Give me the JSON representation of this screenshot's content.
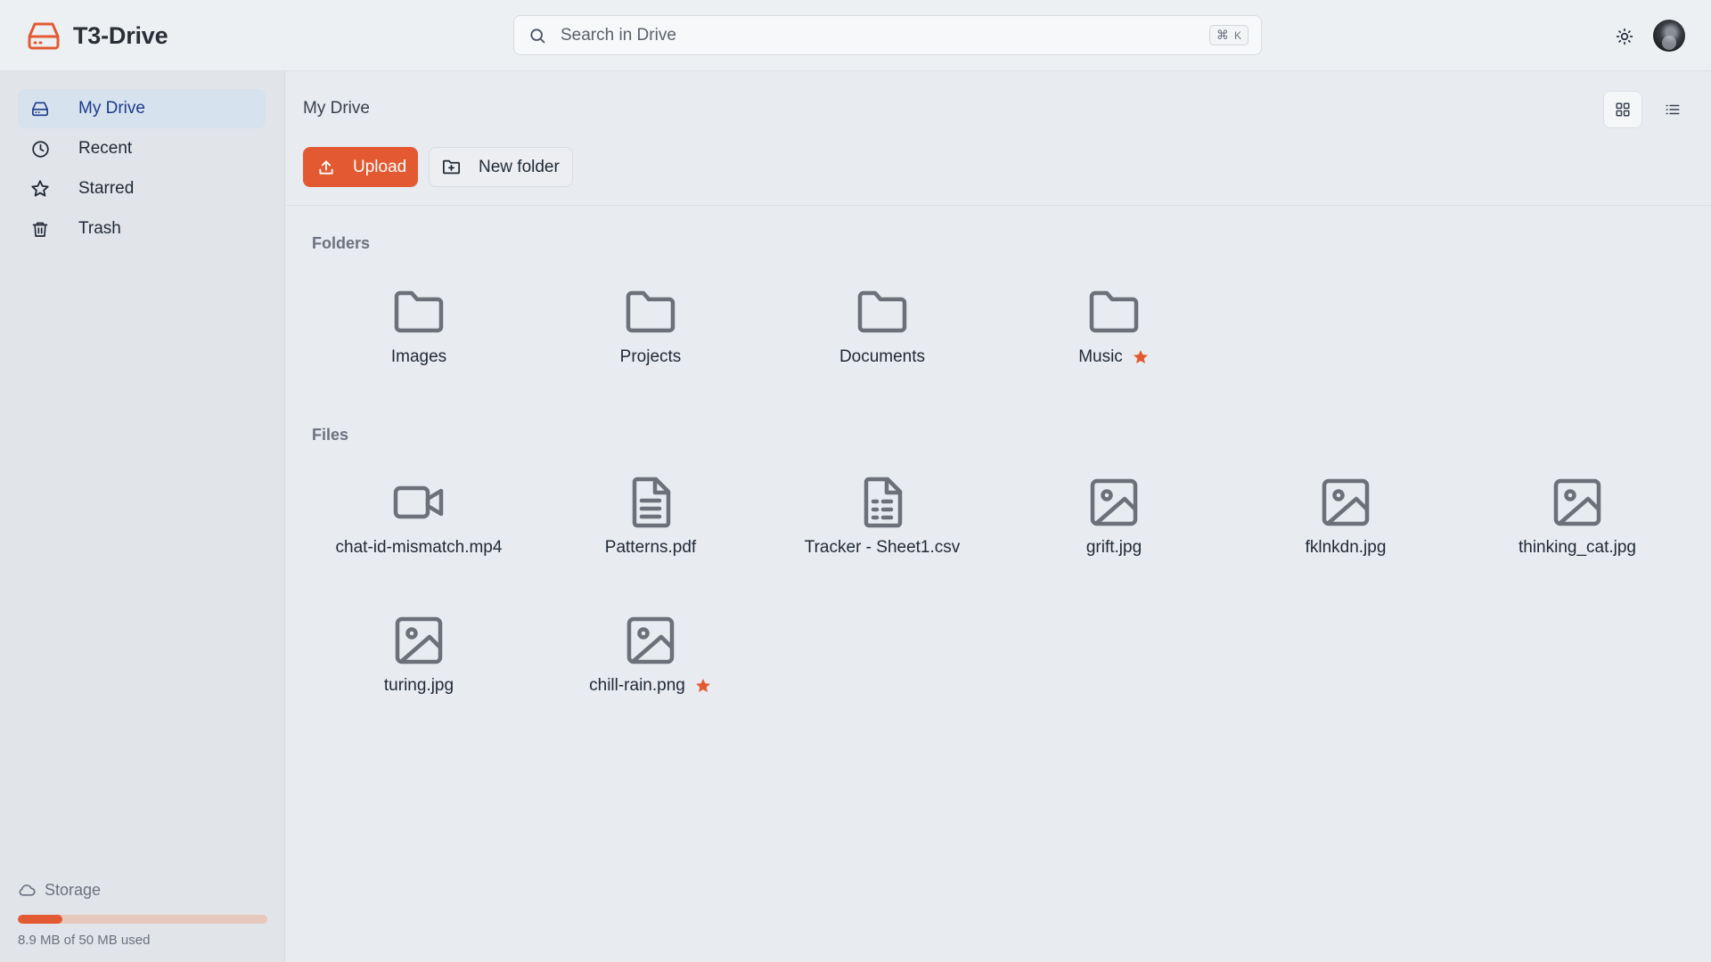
{
  "app": {
    "title": "T3-Drive",
    "brand_color": "#e35a32"
  },
  "header": {
    "search_placeholder": "Search in Drive",
    "shortcut_symbol": "⌘",
    "shortcut_key": "K",
    "theme_icon": "sun-icon",
    "avatar_icon": "user-avatar"
  },
  "sidebar": {
    "items": [
      {
        "label": "My Drive",
        "icon": "drive-icon",
        "active": true
      },
      {
        "label": "Recent",
        "icon": "clock-icon",
        "active": false
      },
      {
        "label": "Starred",
        "icon": "star-icon",
        "active": false
      },
      {
        "label": "Trash",
        "icon": "trash-icon",
        "active": false
      }
    ],
    "storage": {
      "label": "Storage",
      "icon": "cloud-icon",
      "used_text": "8.9 MB of 50 MB used",
      "used_fraction": 0.178
    }
  },
  "main": {
    "breadcrumb": "My Drive",
    "upload_label": "Upload",
    "new_folder_label": "New folder",
    "view_mode": "grid",
    "folders_title": "Folders",
    "files_title": "Files",
    "folders": [
      {
        "name": "Images",
        "starred": false
      },
      {
        "name": "Projects",
        "starred": false
      },
      {
        "name": "Documents",
        "starred": false
      },
      {
        "name": "Music",
        "starred": true
      }
    ],
    "files": [
      {
        "name": "chat-id-mismatch.mp4",
        "icon": "video-icon",
        "starred": false
      },
      {
        "name": "Patterns.pdf",
        "icon": "document-icon",
        "starred": false
      },
      {
        "name": "Tracker - Sheet1.csv",
        "icon": "spreadsheet-icon",
        "starred": false
      },
      {
        "name": "grift.jpg",
        "icon": "image-icon",
        "starred": false
      },
      {
        "name": "fklnkdn.jpg",
        "icon": "image-icon",
        "starred": false
      },
      {
        "name": "thinking_cat.jpg",
        "icon": "image-icon",
        "starred": false
      },
      {
        "name": "turing.jpg",
        "icon": "image-icon",
        "starred": false
      },
      {
        "name": "chill-rain.png",
        "icon": "image-icon",
        "starred": true
      }
    ]
  },
  "colors": {
    "accent": "#e35a32",
    "icon_gray": "#6b7079",
    "active_nav_bg": "#d6e2ee",
    "active_nav_text": "#1e3a8a"
  }
}
